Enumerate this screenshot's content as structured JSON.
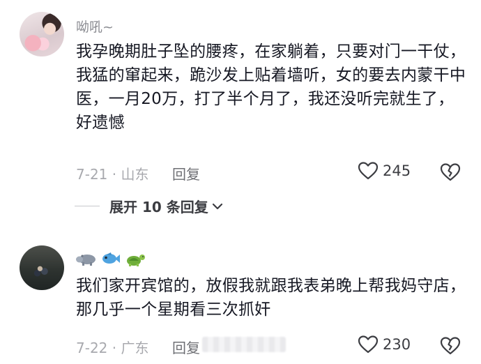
{
  "comments": [
    {
      "username": "呦吼~",
      "content": "我孕晚期肚子坠的腰疼，在家躺着，只要对门一干仗，我猛的窜起来，跪沙发上贴着墙听，女的要去内蒙干中医，一月20万，打了半个月了，我还没听完就生了，好遗憾",
      "date_location": "7-21 · 山东",
      "reply_label": "回复",
      "likes": "245",
      "expand_label": "展开 10 条回复"
    },
    {
      "username_emojis": [
        "hippo-emoji",
        "fish-emoji",
        "turtle-emoji"
      ],
      "content": "我们家开宾馆的，放假我就跟我表弟晚上帮我妈守店，那几乎一个星期看三次抓奸",
      "date_location": "7-22 · 广东",
      "reply_label": "回复",
      "likes": "230"
    }
  ],
  "colors": {
    "text_primary": "#161823",
    "text_secondary": "#8a8b91",
    "icon": "#3c3d42"
  }
}
